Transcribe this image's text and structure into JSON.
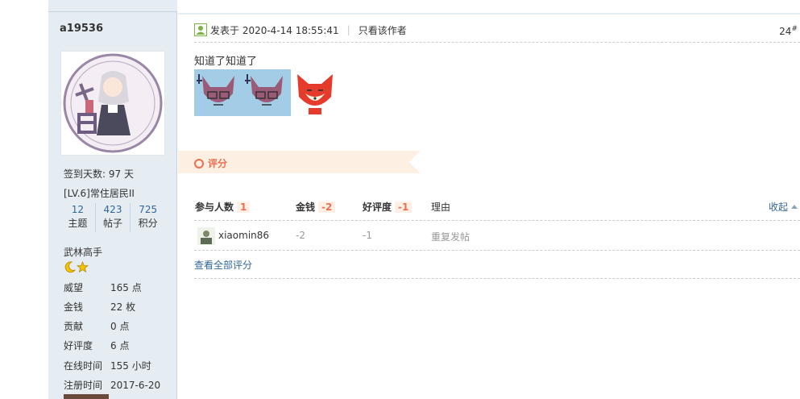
{
  "user": {
    "name": "a19536",
    "checkin": "签到天数: 97 天",
    "level": "[LV.6]常住居民II",
    "stats": [
      {
        "num": "12",
        "label": "主题"
      },
      {
        "num": "423",
        "label": "帖子"
      },
      {
        "num": "725",
        "label": "积分"
      }
    ],
    "title": "武林高手",
    "props": [
      {
        "k": "威望",
        "v": "165 点"
      },
      {
        "k": "金钱",
        "v": "22 枚"
      },
      {
        "k": "贡献",
        "v": "0 点"
      },
      {
        "k": "好评度",
        "v": "6 点"
      },
      {
        "k": "在线时间",
        "v": "155 小时"
      },
      {
        "k": "注册时间",
        "v": "2017-6-20"
      }
    ]
  },
  "post": {
    "posted": "发表于 2020-4-14 18:55:41",
    "only_author": "只看该作者",
    "floor": "24",
    "floor_mark": "#",
    "text": "知道了知道了"
  },
  "rating": {
    "section_title": "评分",
    "headers": {
      "participants": "参与人数",
      "participants_count": "1",
      "money": "金钱",
      "money_total": "-2",
      "goodness": "好评度",
      "goodness_total": "-1",
      "reason": "理由"
    },
    "collapse": "收起",
    "rows": [
      {
        "user": "xiaomin86",
        "money": "-2",
        "goodness": "-1",
        "reason": "重复发帖"
      }
    ],
    "view_all": "查看全部评分"
  },
  "colors": {
    "accent": "#f26c4f",
    "link": "#336699",
    "sidebar": "#e5edf2"
  }
}
